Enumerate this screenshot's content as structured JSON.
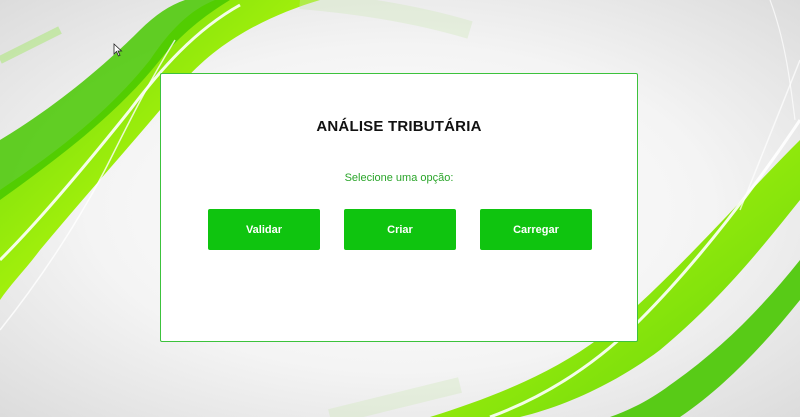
{
  "panel": {
    "title": "ANÁLISE TRIBUTÁRIA",
    "prompt": "Selecione uma opção:"
  },
  "buttons": [
    {
      "label": "Validar"
    },
    {
      "label": "Criar"
    },
    {
      "label": "Carregar"
    }
  ],
  "colors": {
    "accent": "#0fc40f",
    "prompt_text": "#2aa52a",
    "panel_border": "#3cc23c",
    "background_wave": "#7de000"
  },
  "icons": {
    "cursor": "mouse-pointer-icon"
  }
}
